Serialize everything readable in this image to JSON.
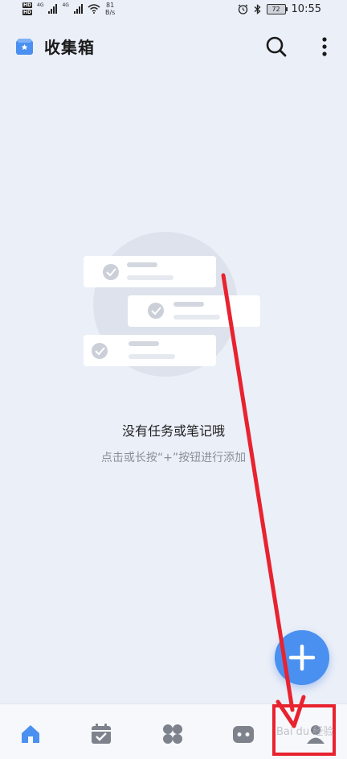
{
  "status_bar": {
    "hd_top": "HD",
    "hd_bottom": "HD",
    "net1": "4G",
    "net2": "4G",
    "speed_value": "81",
    "speed_unit": "B/s",
    "battery": "72",
    "time": "10:55"
  },
  "header": {
    "title": "收集箱",
    "icon": "inbox-star-icon"
  },
  "empty_state": {
    "title": "没有任务或笔记哦",
    "hint": "点击或长按“+”按钮进行添加"
  },
  "fab": {
    "icon": "plus-icon"
  },
  "bottom_nav": {
    "items": [
      {
        "icon": "home-icon",
        "active": true
      },
      {
        "icon": "calendar-check-icon",
        "active": false
      },
      {
        "icon": "grid-icon",
        "active": false
      },
      {
        "icon": "robot-icon",
        "active": false
      },
      {
        "icon": "profile-icon",
        "active": false
      }
    ]
  },
  "watermark": {
    "text": "Bai du 经验"
  },
  "colors": {
    "background": "#ebeff8",
    "accent": "#4a90f0",
    "annotation_red": "#e8232f",
    "nav_icon": "#7d828c"
  }
}
